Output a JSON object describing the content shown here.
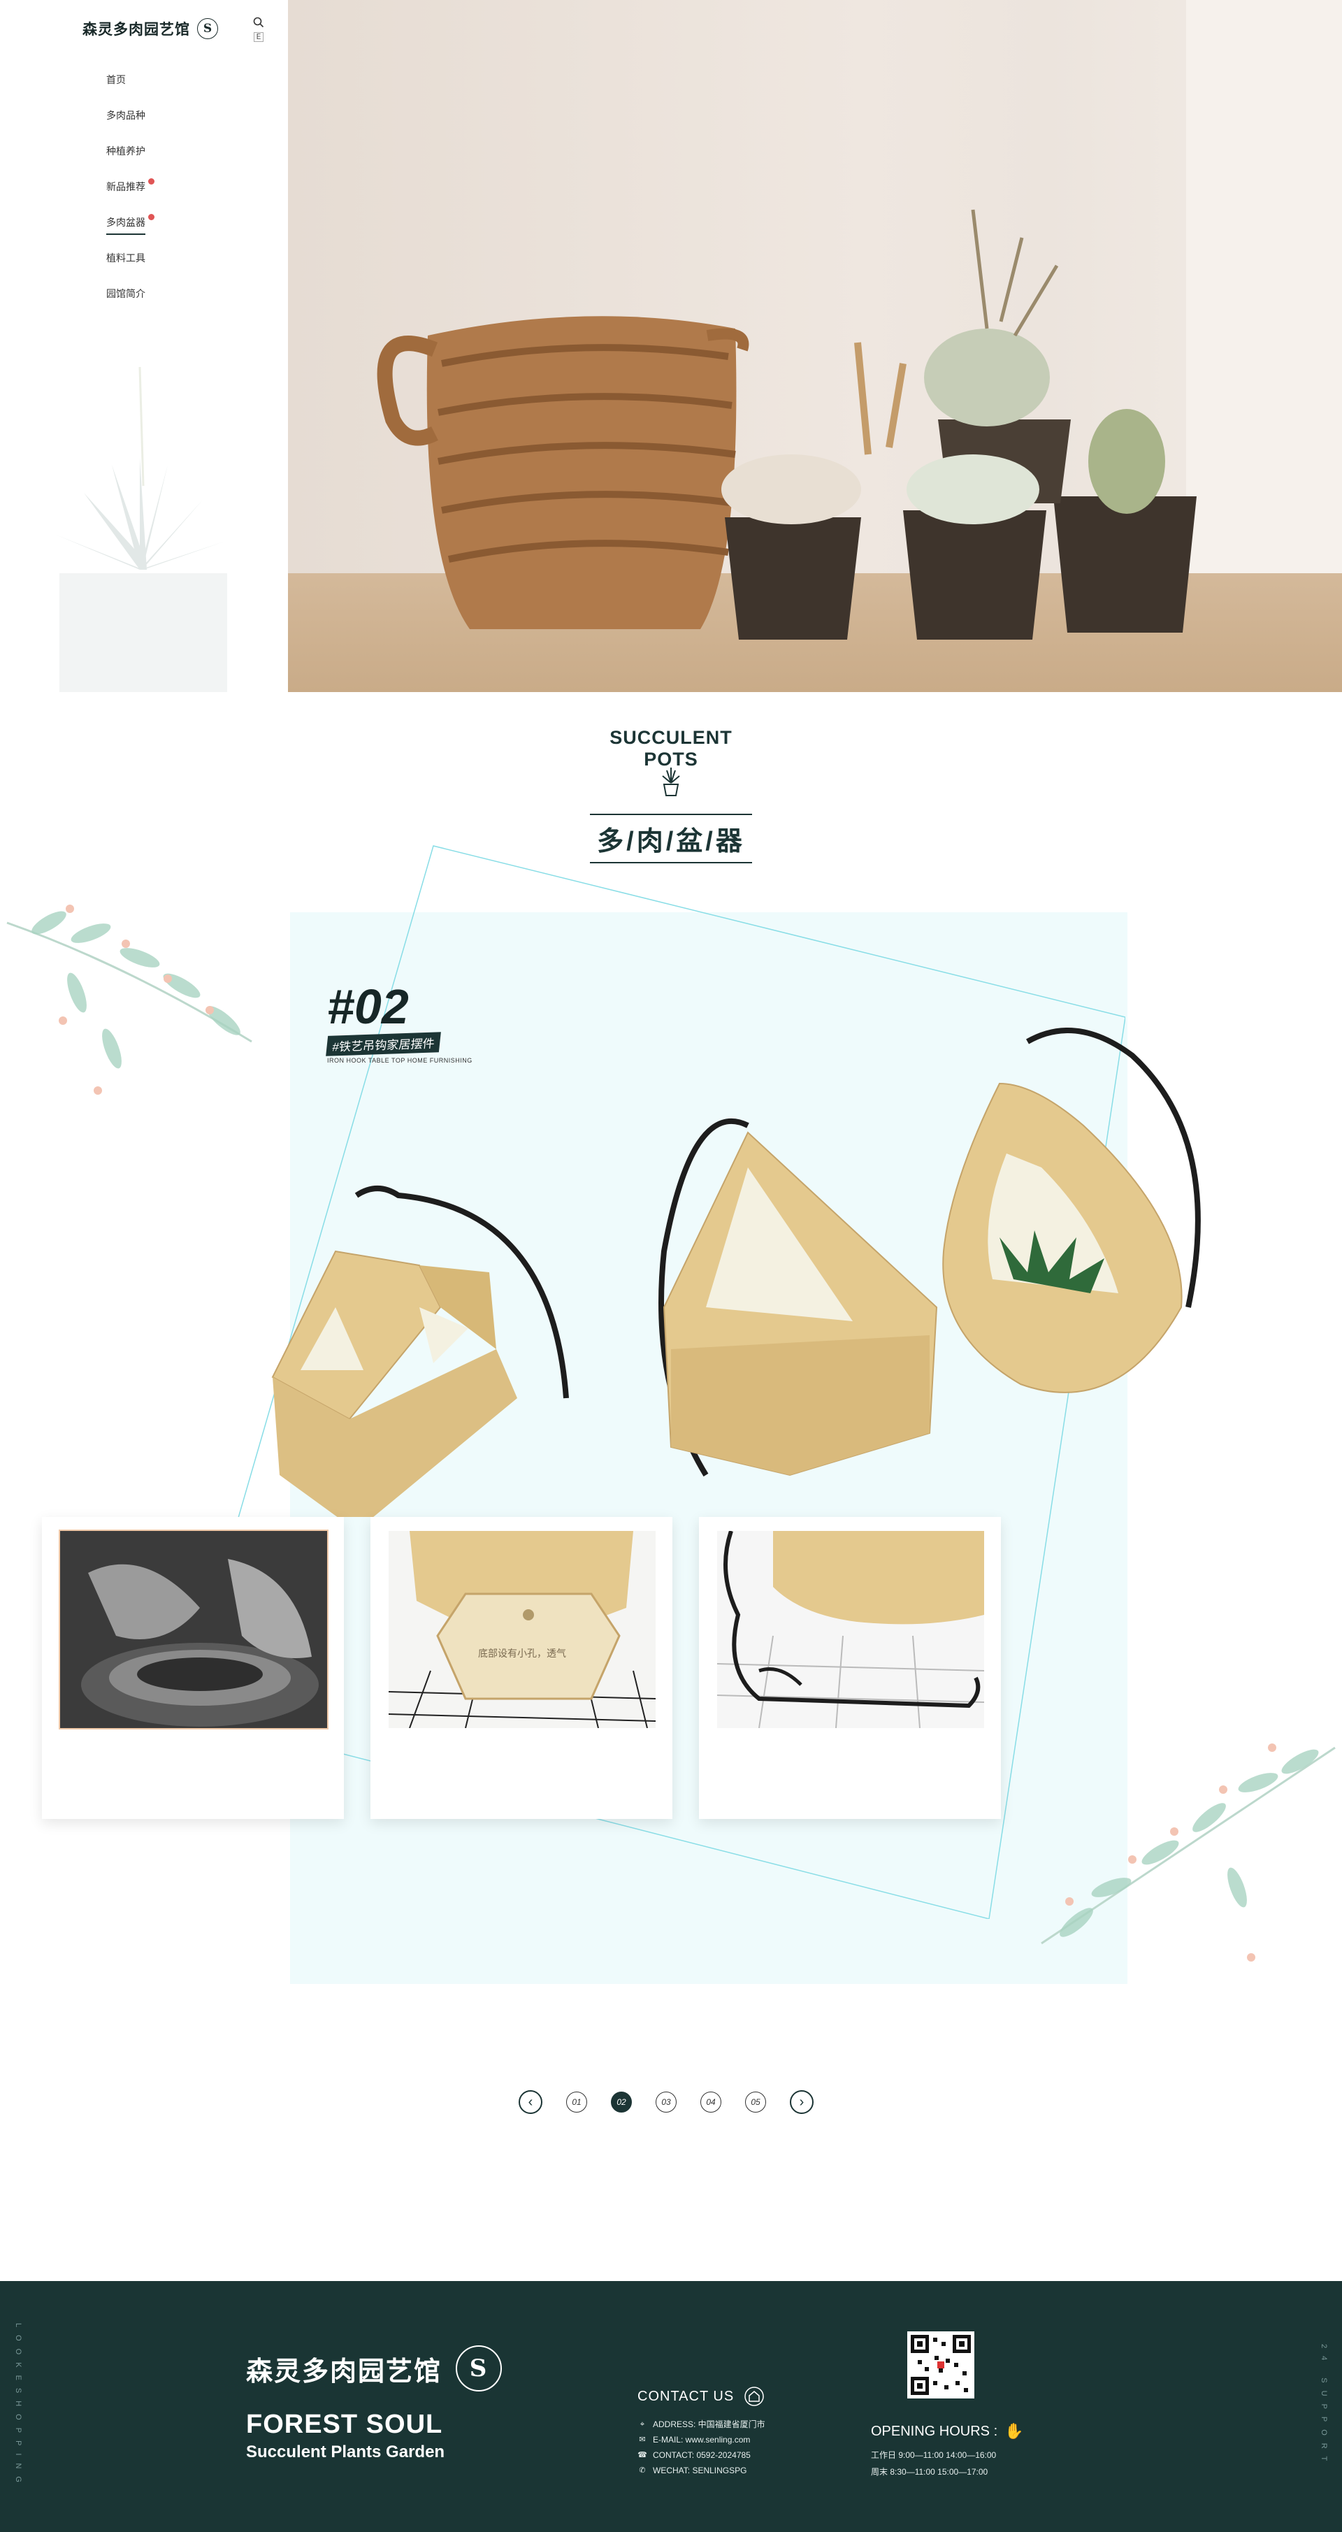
{
  "sidebar": {
    "logo_text": "森灵多肉园艺馆",
    "logo_badge": "S",
    "lang_label": "E",
    "nav": [
      {
        "label": "首页",
        "active": false,
        "dot": false
      },
      {
        "label": "多肉品种",
        "active": false,
        "dot": false
      },
      {
        "label": "种植养护",
        "active": false,
        "dot": false
      },
      {
        "label": "新品推荐",
        "active": false,
        "dot": true
      },
      {
        "label": "多肉盆器",
        "active": true,
        "dot": true
      },
      {
        "label": "植料工具",
        "active": false,
        "dot": false
      },
      {
        "label": "园馆简介",
        "active": false,
        "dot": false
      }
    ]
  },
  "section": {
    "title_en": "SUCCULENT POTS",
    "title_cn": "多/肉/盆/器"
  },
  "showcase": {
    "number": "#02",
    "subtitle": "#铁艺吊钩家居摆件",
    "subtitle_en": "IRON HOOK TABLE TOP HOME FURNISHING",
    "thumb2_caption": "底部设有小孔，透气"
  },
  "pager": {
    "prev": "‹",
    "next": "›",
    "pages": [
      "01",
      "02",
      "03",
      "04",
      "05"
    ],
    "active_index": 1
  },
  "footer": {
    "vertical_left": "LOOKESHOPPING",
    "vertical_right": "24 SUPPORT",
    "brand_cn": "森灵多肉园艺馆",
    "badge": "S",
    "brand_en": "FOREST SOUL",
    "brand_sub": "Succulent Plants Garden",
    "contact_title": "CONTACT US",
    "contact": [
      {
        "icon": "location-icon",
        "text": "ADDRESS: 中国福建省厦门市"
      },
      {
        "icon": "mail-icon",
        "text": "E-MAIL: www.senling.com"
      },
      {
        "icon": "phone-icon",
        "text": "CONTACT: 0592-2024785"
      },
      {
        "icon": "wechat-icon",
        "text": "WECHAT: SENLINGSPG"
      }
    ],
    "hours_title": "OPENING HOURS :",
    "hours": [
      "工作日  9:00—11:00   14:00—16:00",
      "周末    8:30—11:00   15:00—17:00"
    ]
  },
  "colors": {
    "primary": "#1c3535",
    "footer_bg": "#1a3534",
    "panel_bg": "#effbfc",
    "accent_line": "#7fd8e2",
    "nav_dot": "#e05555"
  }
}
